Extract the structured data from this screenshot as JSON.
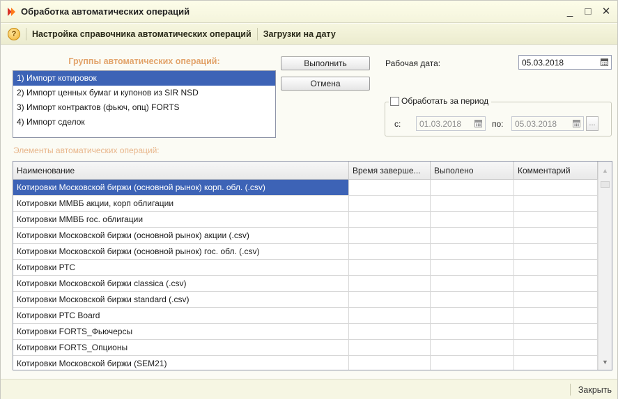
{
  "window": {
    "title": "Обработка автоматических операций",
    "controls": {
      "minimize": "_",
      "maximize": "□",
      "close": "✕"
    }
  },
  "toolbar": {
    "help_label": "?",
    "items": [
      {
        "label": "Настройка справочника автоматических операций"
      },
      {
        "label": "Загрузки на дату"
      }
    ]
  },
  "groups": {
    "caption": "Группы автоматических операций:",
    "items": [
      {
        "label": "1) Импорт котировок",
        "selected": true
      },
      {
        "label": "2) Импорт ценных бумаг и купонов из SIR NSD"
      },
      {
        "label": "3) Импорт контрактов (фьюч, опц) FORTS"
      },
      {
        "label": "4) Импорт сделок"
      }
    ]
  },
  "actions": {
    "execute_label": "Выполнить",
    "cancel_label": "Отмена"
  },
  "work_date": {
    "label": "Рабочая дата:",
    "value": "05.03.2018"
  },
  "period": {
    "checkbox_label": "Обработать за период",
    "checked": false,
    "from_label": "с:",
    "from_value": "01.03.2018",
    "to_label": "по:",
    "to_value": "05.03.2018",
    "dots_label": "..."
  },
  "elements": {
    "caption": "Элементы автоматических операций:",
    "columns": [
      "Наименование",
      "Время заверше...",
      "Выполено",
      "Комментарий"
    ],
    "rows": [
      {
        "name": "Котировки Московской биржи (основной рынок) корп. обл. (.csv)",
        "selected": true
      },
      {
        "name": "Котировки ММВБ акции, корп облигации"
      },
      {
        "name": "Котировки ММВБ гос. облигации"
      },
      {
        "name": "Котировки Московской биржи (основной рынок) акции  (.csv)"
      },
      {
        "name": "Котировки Московской биржи (основной рынок) гос. обл. (.csv)"
      },
      {
        "name": "Котировки РТС"
      },
      {
        "name": "Котировки Московской биржи classica (.csv)"
      },
      {
        "name": "Котировки Московской биржи standard (.csv)"
      },
      {
        "name": "Котировки РТС Board"
      },
      {
        "name": "Котировки FORTS_Фьючерсы"
      },
      {
        "name": "Котировки FORTS_Опционы"
      },
      {
        "name": "Котировки Московской биржи (SEM21)"
      }
    ]
  },
  "footer": {
    "close_label": "Закрыть"
  },
  "colors": {
    "selection": "#3d63b6",
    "caption_orange": "#e2a36a",
    "title_icon": "#d8342a"
  }
}
